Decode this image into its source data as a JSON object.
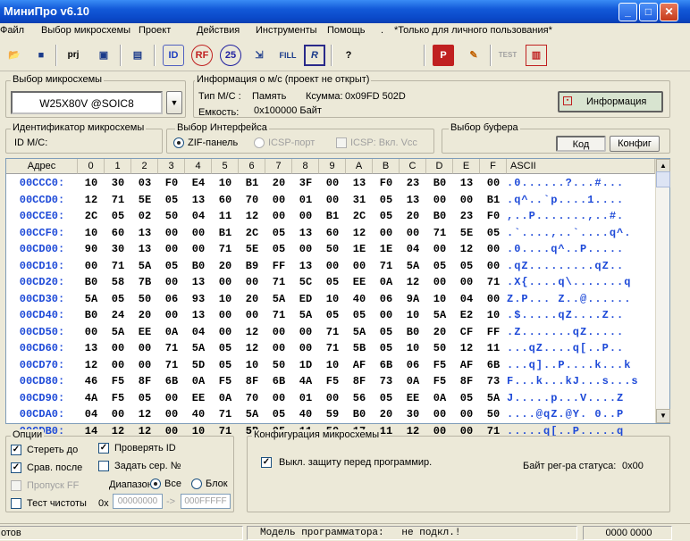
{
  "window": {
    "title": "МиниПро v6.10"
  },
  "menu": {
    "items": [
      "Файл",
      "Выбор микросхемы",
      "Проект",
      "Действия",
      "Инструменты",
      "Помощь",
      ".",
      "*Только для личного пользования*"
    ]
  },
  "toolbar": {
    "prj_label": "prj",
    "id_label": "ID",
    "rf_label": "RF",
    "25_label": "25",
    "fill_label": "FILL",
    "r_label": "R",
    "help_label": "?",
    "p_label": "P",
    "test_label": "TEST"
  },
  "chip_select": {
    "group_label": "Выбор микросхемы",
    "selected": "W25X80V @SOIC8",
    "dropdown_icon": "▼"
  },
  "chip_info": {
    "group_label": "Информация о м/с (проект не открыт)",
    "type_label": "Тип М/С :",
    "type_value": "Память",
    "checksum_label": "Ксумма:",
    "checksum_value": "0x09FD 502D",
    "capacity_label": "Емкость:",
    "capacity_value": "0x100000 Байт",
    "info_button": "Информация"
  },
  "chip_id": {
    "group_label": "Идентификатор микросхемы",
    "label": "ID М/С:"
  },
  "interface": {
    "group_label": "Выбор Интерфейса",
    "zif": "ZIF-панель",
    "icsp": "ICSP-порт",
    "icsp_vcc": "ICSP: Вкл. Vcc"
  },
  "buffer": {
    "group_label": "Выбор буфера",
    "code_button": "Код",
    "config_button": "Конфиг"
  },
  "hex": {
    "header_addr": "Адрес",
    "header_cols": [
      "0",
      "1",
      "2",
      "3",
      "4",
      "5",
      "6",
      "7",
      "8",
      "9",
      "A",
      "B",
      "C",
      "D",
      "E",
      "F"
    ],
    "header_ascii": "ASCII",
    "rows": [
      {
        "addr": "00CCC0:",
        "bytes": [
          "10",
          "30",
          "03",
          "F0",
          "E4",
          "10",
          "B1",
          "20",
          "3F",
          "00",
          "13",
          "F0",
          "23",
          "B0",
          "13",
          "00"
        ],
        "ascii": ".0......?...#..."
      },
      {
        "addr": "00CCD0:",
        "bytes": [
          "12",
          "71",
          "5E",
          "05",
          "13",
          "60",
          "70",
          "00",
          "01",
          "00",
          "31",
          "05",
          "13",
          "00",
          "00",
          "B1"
        ],
        "ascii": ".q^..`p....1...."
      },
      {
        "addr": "00CCE0:",
        "bytes": [
          "2C",
          "05",
          "02",
          "50",
          "04",
          "11",
          "12",
          "00",
          "00",
          "B1",
          "2C",
          "05",
          "20",
          "B0",
          "23",
          "F0"
        ],
        "ascii": ",..P.......,..#."
      },
      {
        "addr": "00CCF0:",
        "bytes": [
          "10",
          "60",
          "13",
          "00",
          "00",
          "B1",
          "2C",
          "05",
          "13",
          "60",
          "12",
          "00",
          "00",
          "71",
          "5E",
          "05"
        ],
        "ascii": ".`....,..`....q^."
      },
      {
        "addr": "00CD00:",
        "bytes": [
          "90",
          "30",
          "13",
          "00",
          "00",
          "71",
          "5E",
          "05",
          "00",
          "50",
          "1E",
          "1E",
          "04",
          "00",
          "12",
          "00"
        ],
        "ascii": ".0....q^..P....."
      },
      {
        "addr": "00CD10:",
        "bytes": [
          "00",
          "71",
          "5A",
          "05",
          "B0",
          "20",
          "B9",
          "FF",
          "13",
          "00",
          "00",
          "71",
          "5A",
          "05",
          "05",
          "00"
        ],
        "ascii": ".qZ.........qZ.."
      },
      {
        "addr": "00CD20:",
        "bytes": [
          "B0",
          "58",
          "7B",
          "00",
          "13",
          "00",
          "00",
          "71",
          "5C",
          "05",
          "EE",
          "0A",
          "12",
          "00",
          "00",
          "71"
        ],
        "ascii": ".X{....q\\.......q"
      },
      {
        "addr": "00CD30:",
        "bytes": [
          "5A",
          "05",
          "50",
          "06",
          "93",
          "10",
          "20",
          "5A",
          "ED",
          "10",
          "40",
          "06",
          "9A",
          "10",
          "04",
          "00"
        ],
        "ascii": "Z.P... Z..@......"
      },
      {
        "addr": "00CD40:",
        "bytes": [
          "B0",
          "24",
          "20",
          "00",
          "13",
          "00",
          "00",
          "71",
          "5A",
          "05",
          "05",
          "00",
          "10",
          "5A",
          "E2",
          "10"
        ],
        "ascii": ".$.....qZ....Z.."
      },
      {
        "addr": "00CD50:",
        "bytes": [
          "00",
          "5A",
          "EE",
          "0A",
          "04",
          "00",
          "12",
          "00",
          "00",
          "71",
          "5A",
          "05",
          "B0",
          "20",
          "CF",
          "FF"
        ],
        "ascii": ".Z.......qZ....."
      },
      {
        "addr": "00CD60:",
        "bytes": [
          "13",
          "00",
          "00",
          "71",
          "5A",
          "05",
          "12",
          "00",
          "00",
          "71",
          "5B",
          "05",
          "10",
          "50",
          "12",
          "11"
        ],
        "ascii": "...qZ....q[..P.."
      },
      {
        "addr": "00CD70:",
        "bytes": [
          "12",
          "00",
          "00",
          "71",
          "5D",
          "05",
          "10",
          "50",
          "1D",
          "10",
          "AF",
          "6B",
          "06",
          "F5",
          "AF",
          "6B"
        ],
        "ascii": "...q]..P....k...k"
      },
      {
        "addr": "00CD80:",
        "bytes": [
          "46",
          "F5",
          "8F",
          "6B",
          "0A",
          "F5",
          "8F",
          "6B",
          "4A",
          "F5",
          "8F",
          "73",
          "0A",
          "F5",
          "8F",
          "73"
        ],
        "ascii": "F...k...kJ...s...s"
      },
      {
        "addr": "00CD90:",
        "bytes": [
          "4A",
          "F5",
          "05",
          "00",
          "EE",
          "0A",
          "70",
          "00",
          "01",
          "00",
          "56",
          "05",
          "EE",
          "0A",
          "05",
          "5A"
        ],
        "ascii": "J.....p...V....Z"
      },
      {
        "addr": "00CDA0:",
        "bytes": [
          "04",
          "00",
          "12",
          "00",
          "40",
          "71",
          "5A",
          "05",
          "40",
          "59",
          "B0",
          "20",
          "30",
          "00",
          "00",
          "50"
        ],
        "ascii": "....@qZ.@Y. 0..P"
      },
      {
        "addr": "00CDB0:",
        "bytes": [
          "14",
          "12",
          "12",
          "00",
          "10",
          "71",
          "5B",
          "05",
          "11",
          "50",
          "17",
          "11",
          "12",
          "00",
          "00",
          "71"
        ],
        "ascii": ".....q[..P.....q"
      }
    ]
  },
  "options": {
    "group_label": "Опции",
    "erase": "Стереть до",
    "verify_after": "Срав. после",
    "skip_ff": "Пропуск FF",
    "blank_test": "Тест чистоты",
    "verify_id": "Проверять ID",
    "set_serial": "Задать сер. №",
    "range_label": "Диапазон",
    "all": "Все",
    "block": "Блок",
    "prefix": "0x",
    "from": "00000000",
    "arrow": "->",
    "to": "000FFFFF"
  },
  "config": {
    "group_label": "Конфигурация микросхемы",
    "protect_off": "Выкл. защиту перед программир.",
    "status_label": "Байт рег-ра статуса:",
    "status_value": "0x00"
  },
  "status": {
    "left": "отов",
    "model": "Модель программатора:   не подкл.!",
    "right": "0000 0000"
  }
}
